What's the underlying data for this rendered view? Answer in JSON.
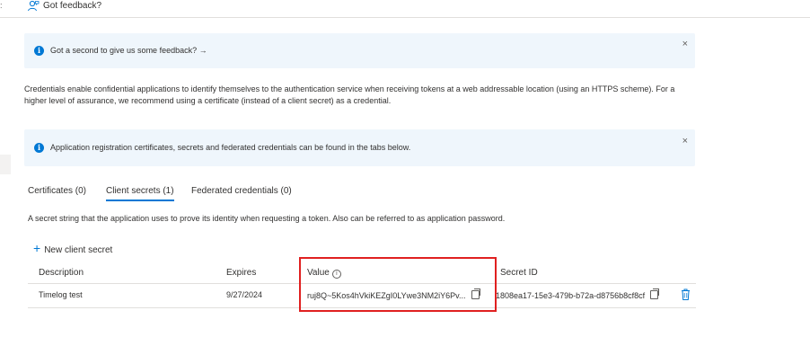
{
  "toolbar": {
    "feedback_label": "Got feedback?",
    "left_glyph": ":"
  },
  "banner_feedback": {
    "text": "Got a second to give us some feedback? →",
    "close": "×"
  },
  "description": "Credentials enable confidential applications to identify themselves to the authentication service when receiving tokens at a web addressable location (using an HTTPS scheme). For a higher level of assurance, we recommend using a certificate (instead of a client secret) as a credential.",
  "banner_info": {
    "text": "Application registration certificates, secrets and federated credentials can be found in the tabs below.",
    "close": "×"
  },
  "tabs": [
    {
      "label": "Certificates (0)",
      "active": false
    },
    {
      "label": "Client secrets (1)",
      "active": true
    },
    {
      "label": "Federated credentials (0)",
      "active": false
    }
  ],
  "secret_help": "A secret string that the application uses to prove its identity when requesting a token. Also can be referred to as application password.",
  "new_secret_label": "New client secret",
  "table": {
    "headers": {
      "description": "Description",
      "expires": "Expires",
      "value": "Value",
      "secret_id": "Secret ID"
    },
    "rows": [
      {
        "description": "Timelog test",
        "expires": "9/27/2024",
        "value": "ruj8Q~5Kos4hVkiKEZgI0LYwe3NM2iY6Pv...",
        "secret_id": "1808ea17-15e3-479b-b72a-d8756b8cf8cf"
      }
    ]
  },
  "colors": {
    "accent": "#0078d4",
    "banner_bg": "#eff6fc",
    "highlight": "#e02020"
  }
}
